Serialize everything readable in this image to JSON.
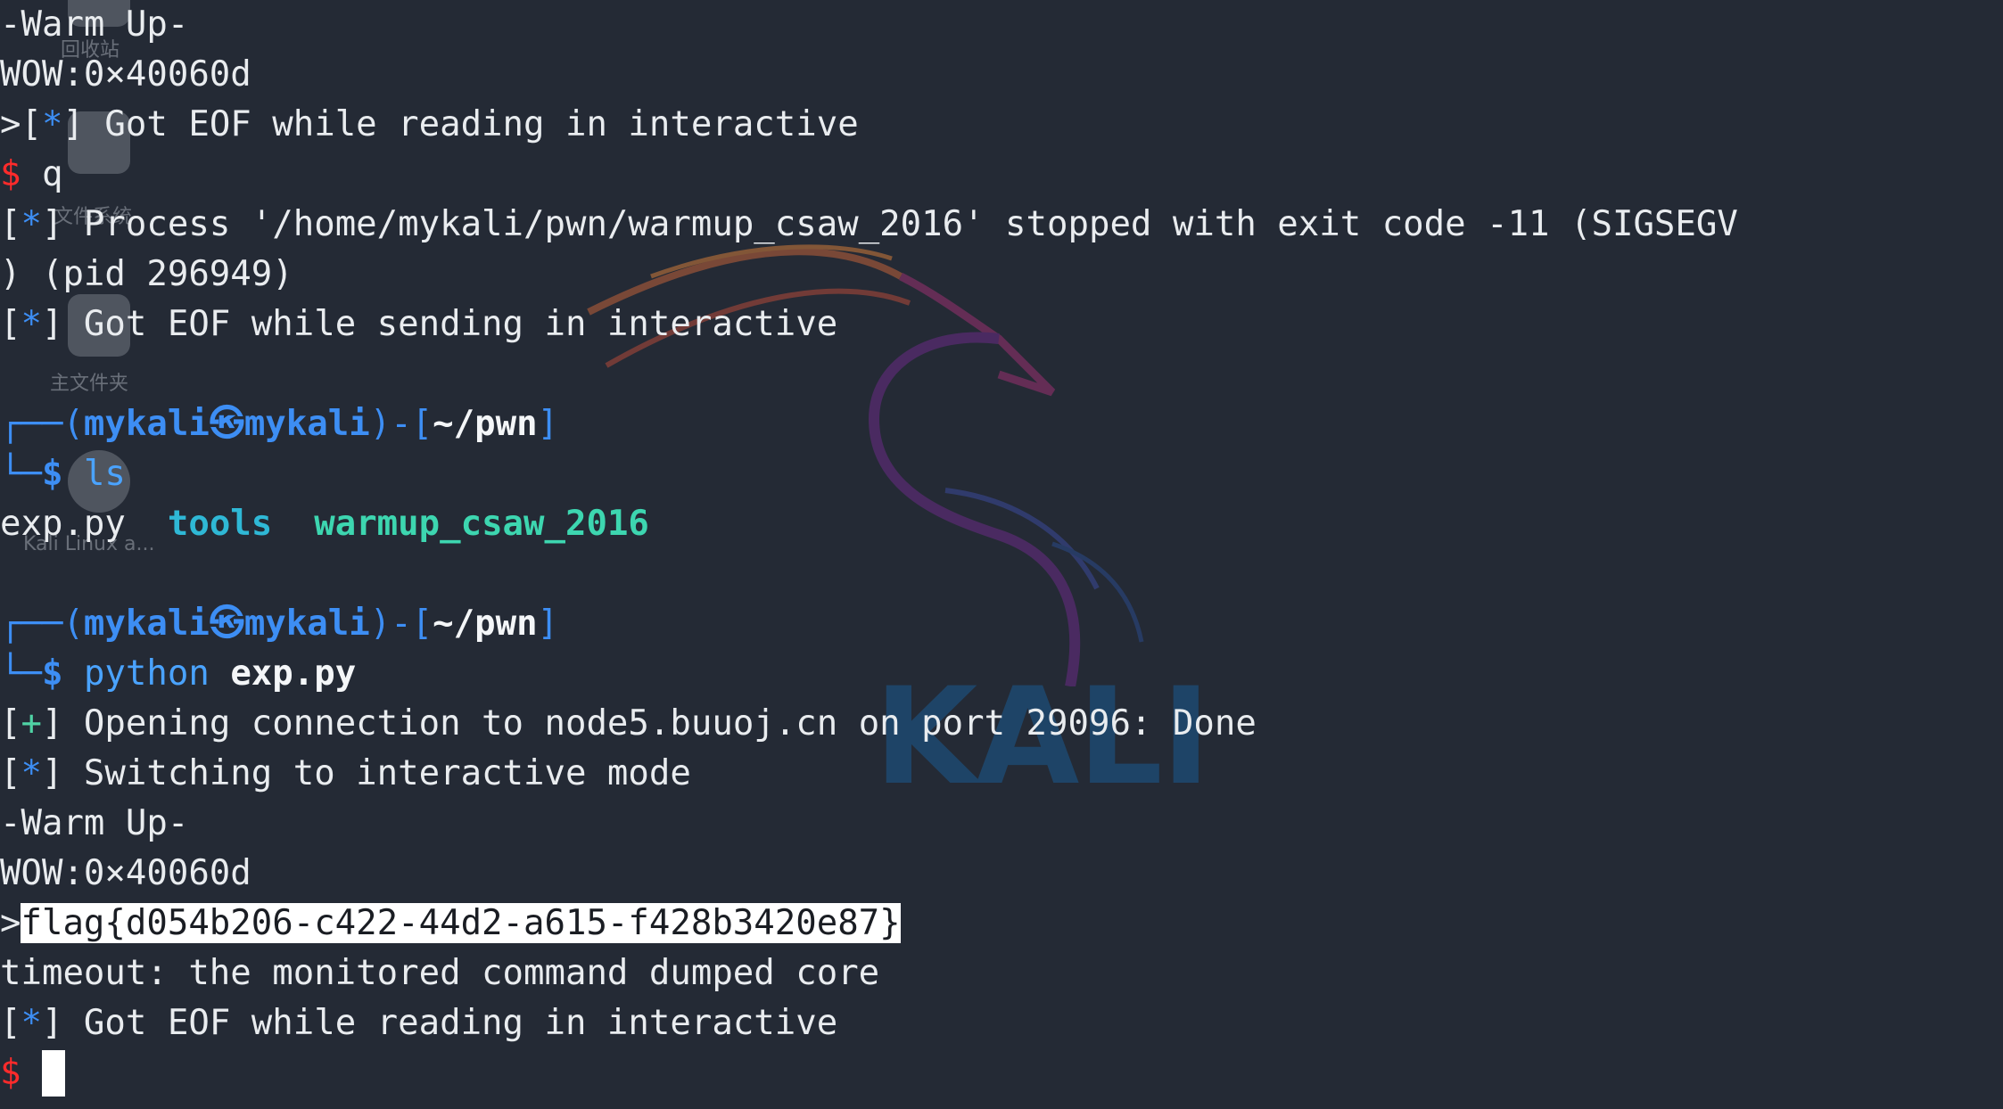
{
  "wallpaper": {
    "brand_text": "KALI",
    "desktop_icons": [
      {
        "label": "回收站"
      },
      {
        "label": "文件系统"
      },
      {
        "label": "主文件夹"
      },
      {
        "label": "Kali Linux a..."
      }
    ]
  },
  "colors": {
    "background": "#242a35",
    "prompt_blue": "#3d8ef4",
    "error_red": "#ff2b2b",
    "success_green": "#4fd3a5",
    "dir_cyan": "#2fb8d6",
    "exec_teal": "#3dd6b0"
  },
  "terminal": {
    "l1": "-Warm Up-",
    "l2": "WOW:0×40060d",
    "l3_prefix": ">[",
    "star": "*",
    "bracket_close": "]",
    "l3_text": " Got EOF while reading in interactive",
    "dollar": "$",
    "l4_text": " q",
    "bracket_open": "[",
    "l5_text": " Process '/home/mykali/pwn/warmup_csaw_2016' stopped with exit code -11 (SIGSEGV",
    "l6": ") (pid 296949)",
    "l7_text": " Got EOF while sending in interactive",
    "prompt_top": "┌──(",
    "prompt_user": "mykali",
    "prompt_at": "㉿",
    "prompt_host": "mykali",
    "prompt_mid": ")-[",
    "prompt_dir": "~/pwn",
    "prompt_end": "]",
    "prompt_bottom": "└─",
    "cmd1": "ls",
    "ls_file": "exp.py",
    "ls_dir": "tools",
    "ls_exec": "warmup_csaw_2016",
    "cmd2_prog": "python",
    "cmd2_arg": "exp.py",
    "plus": "+",
    "l14_text": " Opening connection to node5.buuoj.cn on port 29096: Done",
    "l15_text": " Switching to interactive mode",
    "l16": "-Warm Up-",
    "l17": "WOW:0×40060d",
    "l18_prefix": ">",
    "flag": "flag{d054b206-c422-44d2-a615-f428b3420e87}",
    "l19": "timeout: the monitored command dumped core",
    "l20_text": " Got EOF while reading in interactive"
  }
}
